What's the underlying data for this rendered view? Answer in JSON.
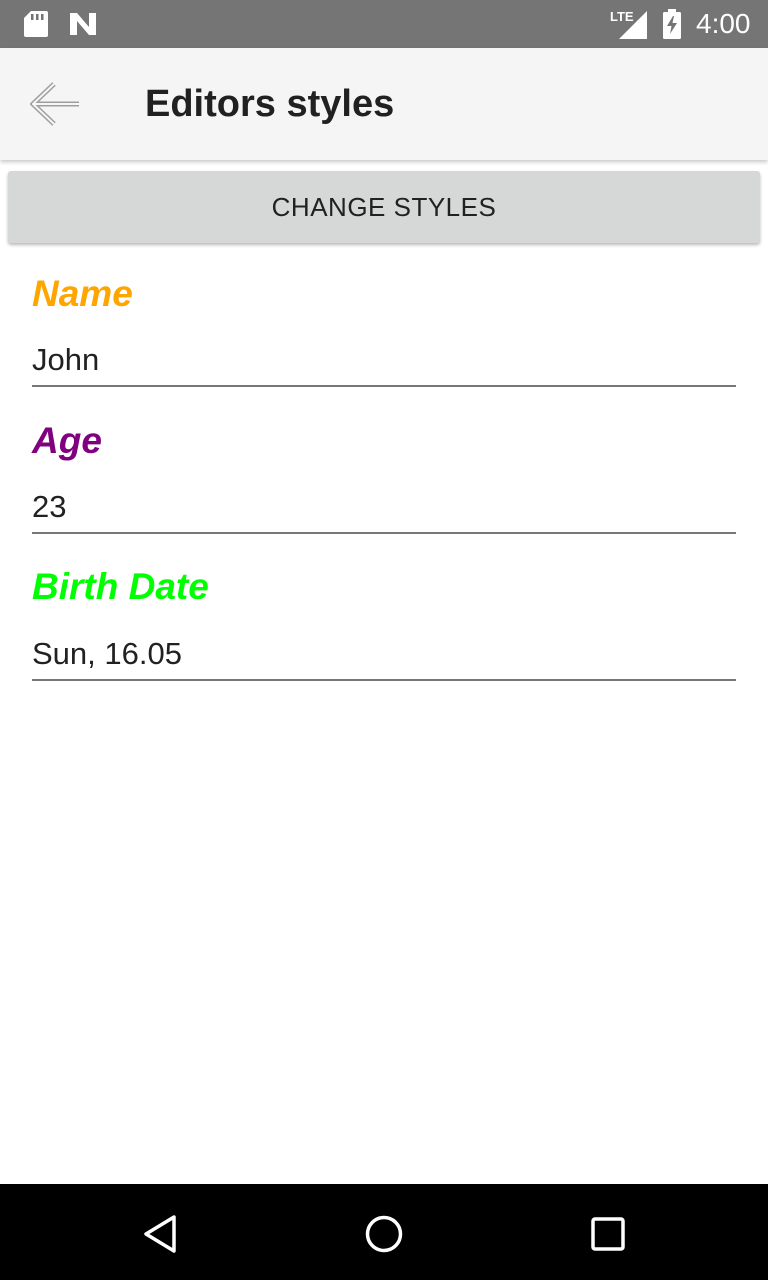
{
  "status_bar": {
    "time": "4:00",
    "network": "LTE",
    "icons": [
      "sd-card-icon",
      "n-notification-icon",
      "signal-icon",
      "battery-charging-icon"
    ]
  },
  "app_bar": {
    "title": "Editors styles",
    "back_icon": "arrow-back-icon"
  },
  "actions": {
    "change_styles_label": "CHANGE STYLES"
  },
  "form": {
    "fields": [
      {
        "label": "Name",
        "value": "John",
        "label_color": "#ffa500"
      },
      {
        "label": "Age",
        "value": "23",
        "label_color": "#800080"
      },
      {
        "label": "Birth Date",
        "value": "Sun, 16.05",
        "label_color": "#00ff00"
      }
    ]
  },
  "nav_bar": {
    "icons": [
      "back-triangle-icon",
      "home-circle-icon",
      "recents-square-icon"
    ]
  },
  "colors": {
    "status_bar_bg": "#757575",
    "app_bar_bg": "#f5f5f5",
    "button_bg": "#d6d7d7",
    "nav_bar_bg": "#000000"
  }
}
